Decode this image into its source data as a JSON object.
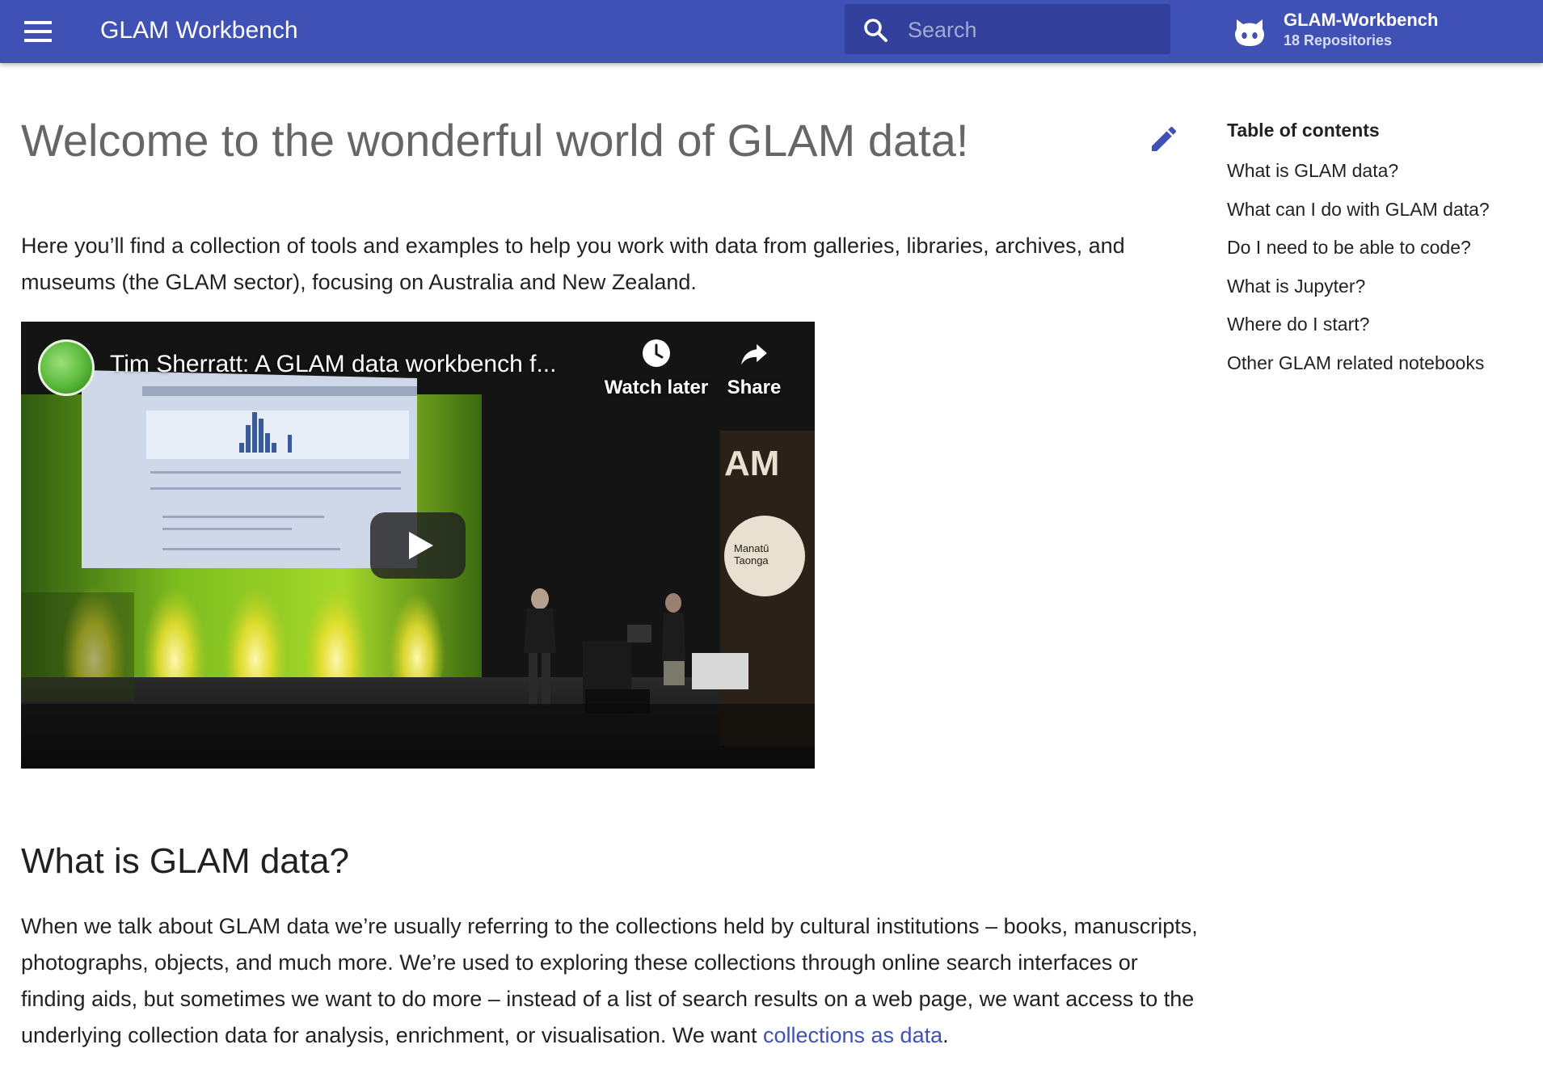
{
  "header": {
    "site_title": "GLAM Workbench",
    "search_placeholder": "Search",
    "search_value": "",
    "repo_name": "GLAM-Workbench",
    "repo_count": "18 Repositories",
    "icons": [
      "menu-icon",
      "search-icon",
      "github-icon"
    ]
  },
  "main": {
    "title": "Welcome to the wonderful world of GLAM data!",
    "intro": "Here you’ll find a collection of tools and examples to help you work with data from galleries, libraries, archives, and museums (the GLAM sector), focusing on Australia and New Zealand.",
    "video": {
      "title": "Tim Sherratt: A GLAM data workbench f...",
      "watch_later": "Watch later",
      "share": "Share",
      "sign_text": "AM",
      "logo_text_1": "Manatū",
      "logo_text_2": "Taonga"
    },
    "section_heading": "What is GLAM data?",
    "section_text": "When we talk about GLAM data we’re usually referring to the collections held by cultural institutions – books, manuscripts, photographs, objects, and much more. We’re used to exploring these collections through online search interfaces or finding aids, but sometimes we want to do more – instead of a list of search results on a web page, we want access to the underlying collection data for analysis, enrichment, or visualisation. We want ",
    "section_link": "collections as data",
    "section_end": "."
  },
  "toc": {
    "title": "Table of contents",
    "items": [
      "What is GLAM data?",
      "What can I do with GLAM data?",
      "Do I need to be able to code?",
      "What is Jupyter?",
      "Where do I start?",
      "Other GLAM related notebooks"
    ]
  },
  "colors": {
    "header_bg": "#3f51b5",
    "search_bg": "#32409b",
    "link": "#3f51b5"
  }
}
